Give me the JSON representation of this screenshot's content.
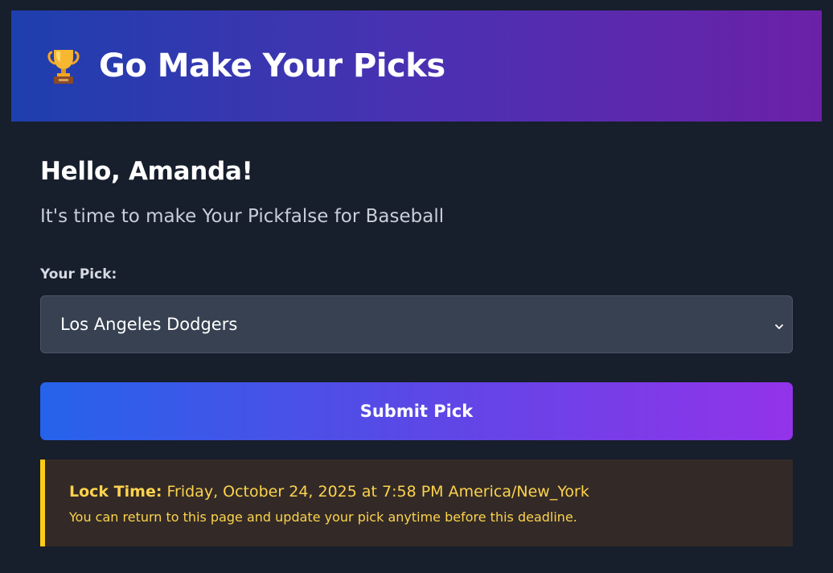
{
  "header": {
    "icon": "trophy-icon",
    "title": "Go Make Your Picks"
  },
  "greeting": "Hello, Amanda!",
  "subtitle": "It's time to make Your Pickfalse for Baseball",
  "form": {
    "pick_label": "Your Pick:",
    "selected_team": "Los Angeles Dodgers",
    "dropdown_icon": "chevron-down-icon",
    "submit_label": "Submit Pick"
  },
  "lock_notice": {
    "label": "Lock Time:",
    "time": "Friday, October 24, 2025 at 7:58 PM America/New_York",
    "note": "You can return to this page and update your pick anytime before this deadline."
  },
  "colors": {
    "background": "#171e2c",
    "header_gradient_start": "#1e3fae",
    "header_gradient_end": "#6b21a8",
    "button_gradient_start": "#2563eb",
    "button_gradient_end": "#9333ea",
    "notice_background": "#332a27",
    "notice_accent": "#facc15"
  }
}
